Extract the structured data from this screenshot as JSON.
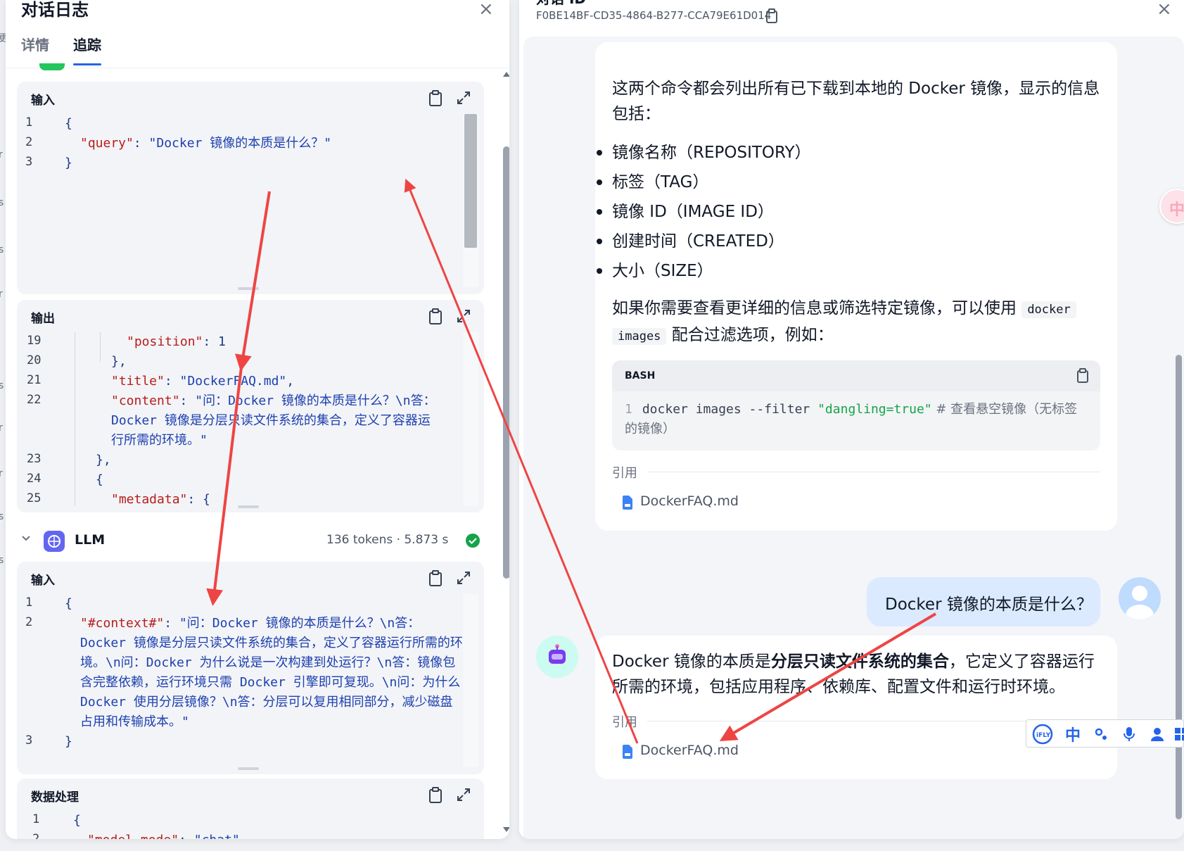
{
  "left_edge": [
    "更",
    "r",
    "s",
    "s",
    "r",
    "s",
    "r",
    "r",
    "s",
    "s"
  ],
  "log_panel": {
    "title": "对话日志",
    "tabs": [
      "详情",
      "追踪"
    ],
    "active_tab": "追踪",
    "input_card": {
      "title": "输入",
      "lines": [
        {
          "n": "1",
          "text": "{"
        },
        {
          "n": "2",
          "key": "\"query\"",
          "value": "\"Docker 镜像的本质是什么？\""
        },
        {
          "n": "3",
          "text": "}"
        }
      ]
    },
    "output_card": {
      "title": "输出",
      "lines": [
        {
          "n": "19",
          "key": "\"position\"",
          "text": ": 1"
        },
        {
          "n": "20",
          "text": "},"
        },
        {
          "n": "21",
          "key": "\"title\"",
          "value": "\"DockerFAQ.md\"",
          "suffix": ","
        },
        {
          "n": "22",
          "key": "\"content\"",
          "value": "\"问：Docker 镜像的本质是什么？\\n答：Docker 镜像是分层只读文件系统的集合，定义了容器运行所需的环境。\""
        },
        {
          "n": "23",
          "text": "},"
        },
        {
          "n": "24",
          "text": "{"
        },
        {
          "n": "25",
          "key": "\"metadata\"",
          "text": ": {"
        }
      ]
    },
    "llm_node": {
      "name": "LLM",
      "meta": "136 tokens · 5.873 s"
    },
    "llm_input_card": {
      "title": "输入",
      "lines": [
        {
          "n": "1",
          "text": "{"
        },
        {
          "n": "2",
          "key": "\"#context#\"",
          "value": "\"问：Docker 镜像的本质是什么？\\n答：Docker 镜像是分层只读文件系统的集合，定义了容器运行所需的环境。\\n问：Docker 为什么说是一次构建到处运行？\\n答：镜像包含完整依赖，运行环境只需 Docker 引擎即可复现。\\n问：为什么 Docker 使用分层镜像？\\n答：分层可以复用相同部分，减少磁盘占用和传输成本。\""
        },
        {
          "n": "3",
          "text": "}"
        }
      ]
    },
    "data_card": {
      "title": "数据处理",
      "lines": [
        {
          "n": "1",
          "text": "{"
        },
        {
          "n": "2",
          "key": "\"model_mode\"",
          "value": "\"chat\""
        }
      ]
    }
  },
  "chat_panel": {
    "title": "对话 ID",
    "conversation_id": "F0BE14BF-CD35-4864-B277-CCA79E61D014",
    "answer_1": {
      "intro": "这两个命令都会列出所有已下载到本地的 Docker 镜像，显示的信息包括：",
      "bullets": [
        "镜像名称（REPOSITORY）",
        "标签（TAG）",
        "镜像 ID（IMAGE ID）",
        "创建时间（CREATED）",
        "大小（SIZE）"
      ],
      "followup_before": "如果你需要查看更详细的信息或筛选特定镜像，可以使用",
      "inline_code_1": "docker",
      "inline_code_2": "images",
      "followup_after": "配合过滤选项，例如：",
      "code_lang": "BASH",
      "code_line_no": "1",
      "code_cmd": "docker images --filter ",
      "code_str": "\"dangling=true\"",
      "code_comment": "  # 查看悬空镜像（无标签的镜像）",
      "ref_label": "引用",
      "ref_file": "DockerFAQ.md"
    },
    "user_question": "Docker 镜像的本质是什么？",
    "answer_2": {
      "text_before": "Docker 镜像的本质是",
      "text_bold": "分层只读文件系统的集合",
      "text_after": "，它定义了容器运行所需的环境，包括应用程序、依赖库、配置文件和运行时环境。",
      "ref_label": "引用",
      "ref_file": "DockerFAQ.md"
    },
    "ime_toolbar": [
      "iFLY",
      "中",
      "°,",
      "mic",
      "user",
      "grid"
    ],
    "side_badge": "中"
  },
  "colors": {
    "accent": "#2563eb",
    "annotation_arrow": "#ef4444",
    "success": "#16a34a",
    "user_bubble": "#dbeafe"
  }
}
